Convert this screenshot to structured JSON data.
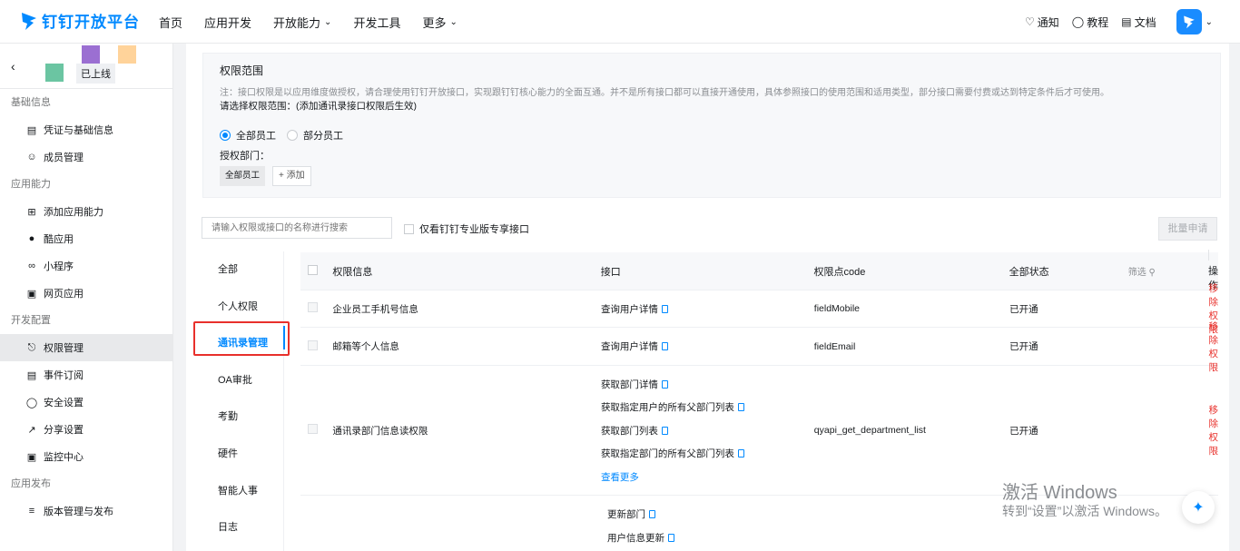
{
  "header": {
    "logo_text": "钉钉开放平台",
    "nav": [
      {
        "label": "首页",
        "dropdown": false
      },
      {
        "label": "应用开发",
        "dropdown": false
      },
      {
        "label": "开放能力",
        "dropdown": true
      },
      {
        "label": "开发工具",
        "dropdown": false
      },
      {
        "label": "更多",
        "dropdown": true
      }
    ],
    "tools": [
      {
        "label": "通知",
        "icon": "bell-icon"
      },
      {
        "label": "教程",
        "icon": "lightbulb-icon"
      },
      {
        "label": "文档",
        "icon": "book-icon"
      }
    ],
    "accent_color": "#0089ff"
  },
  "sidebar": {
    "app_status": "已上线",
    "groups": [
      {
        "title": "基础信息",
        "items": [
          {
            "label": "凭证与基础信息",
            "icon": "credential-icon"
          },
          {
            "label": "成员管理",
            "icon": "user-icon"
          }
        ]
      },
      {
        "title": "应用能力",
        "items": [
          {
            "label": "添加应用能力",
            "icon": "grid-plus-icon"
          },
          {
            "label": "酷应用",
            "icon": "cool-app-icon"
          },
          {
            "label": "小程序",
            "icon": "mini-program-icon"
          },
          {
            "label": "网页应用",
            "icon": "web-app-icon"
          }
        ]
      },
      {
        "title": "开发配置",
        "items": [
          {
            "label": "权限管理",
            "icon": "lock-icon",
            "active": true
          },
          {
            "label": "事件订阅",
            "icon": "event-icon"
          },
          {
            "label": "安全设置",
            "icon": "shield-icon"
          },
          {
            "label": "分享设置",
            "icon": "share-icon"
          },
          {
            "label": "监控中心",
            "icon": "monitor-icon"
          }
        ]
      },
      {
        "title": "应用发布",
        "items": [
          {
            "label": "版本管理与发布",
            "icon": "layers-icon"
          }
        ]
      }
    ]
  },
  "scope": {
    "title": "权限范围",
    "note": "注：接口权限是以应用维度做授权，请合理使用钉钉开放接口，实现跟钉钉核心能力的全面互通。并不是所有接口都可以直接开通使用，具体参照接口的使用范围和适用类型，部分接口需要付费或达到特定条件后才可使用。",
    "select_hint": "请选择权限范围：(添加通讯录接口权限后生效)",
    "radio_all": "全部员工",
    "radio_partial": "部分员工",
    "dept_label": "授权部门：",
    "dept_tag": "全部员工",
    "add_label": "+ 添加"
  },
  "filter": {
    "search_placeholder": "请输入权限或接口的名称进行搜索",
    "pro_only_label": "仅看钉钉专业版专享接口",
    "batch_label": "批量申请"
  },
  "categories": [
    "全部",
    "个人权限",
    "通讯录管理",
    "OA审批",
    "考勤",
    "硬件",
    "智能人事",
    "日志"
  ],
  "active_category": "通讯录管理",
  "table": {
    "headers": {
      "info": "权限信息",
      "api": "接口",
      "code": "权限点code",
      "status": "全部状态",
      "filter": "筛选",
      "action": "操作"
    },
    "rows": [
      {
        "info": "企业员工手机号信息",
        "apis": [
          "查询用户详情"
        ],
        "code": "fieldMobile",
        "status": "已开通",
        "action": "移除权限"
      },
      {
        "info": "邮箱等个人信息",
        "apis": [
          "查询用户详情"
        ],
        "code": "fieldEmail",
        "status": "已开通",
        "action": "移除权限"
      },
      {
        "info": "通讯录部门信息读权限",
        "apis": [
          "获取部门详情",
          "获取指定用户的所有父部门列表",
          "获取部门列表",
          "获取指定部门的所有父部门列表"
        ],
        "more": "查看更多",
        "code": "qyapi_get_department_list",
        "status": "已开通",
        "action": "移除权限"
      },
      {
        "info": "",
        "apis": [
          "更新部门",
          "用户信息更新"
        ],
        "code": "",
        "status": "",
        "action": ""
      }
    ]
  },
  "watermark": {
    "title": "激活 Windows",
    "sub": "转到“设置”以激活 Windows。"
  }
}
